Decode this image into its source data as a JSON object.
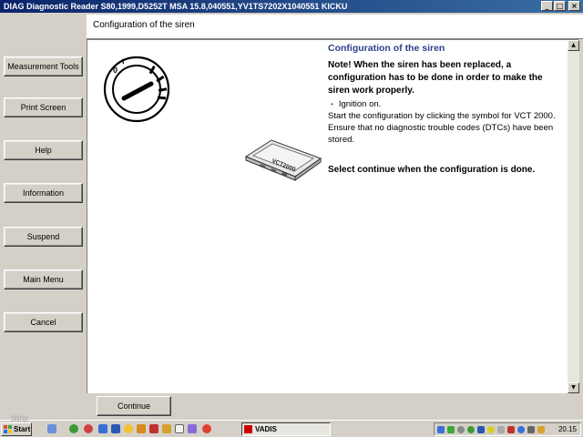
{
  "window": {
    "title": "DIAG Diagnostic Reader S80,1999,D5252T MSA 15.8,040551,YV1TS7202X1040551 KICKU",
    "minimize_label": "_",
    "restore_label": "□",
    "close_label": "×"
  },
  "nav": {
    "items": [
      {
        "label": "Measurement Tools"
      },
      {
        "label": "Print Screen"
      },
      {
        "label": "Help"
      },
      {
        "label": "Information"
      },
      {
        "label": "Suspend"
      },
      {
        "label": "Main Menu"
      },
      {
        "label": "Cancel"
      }
    ]
  },
  "header": {
    "title": "Configuration of the siren"
  },
  "content": {
    "title": "Configuration of the siren",
    "note": "Note! When the siren has been replaced, a configuration has to be done in order to make the siren work properly.",
    "bullet": "Ignition on.",
    "line1": "Start the configuration by clicking the symbol for VCT 2000.",
    "line2": "Ensure that no diagnostic trouble codes (DTCs) have been stored.",
    "final": "Select continue when the configuration is done.",
    "device_label": "VCT2000",
    "scroll_up": "▲",
    "scroll_down": "▼"
  },
  "footer": {
    "continue_label": "Continue"
  },
  "taskbar": {
    "start_label": "Start",
    "task_label": "VADIS",
    "clock": "20.15",
    "watermark": "klokp"
  },
  "colors": {
    "title_blue": "#2c3f8e",
    "titlebar_start": "#0a246a",
    "titlebar_end": "#3a6ea5",
    "face": "#d4d0c8"
  }
}
